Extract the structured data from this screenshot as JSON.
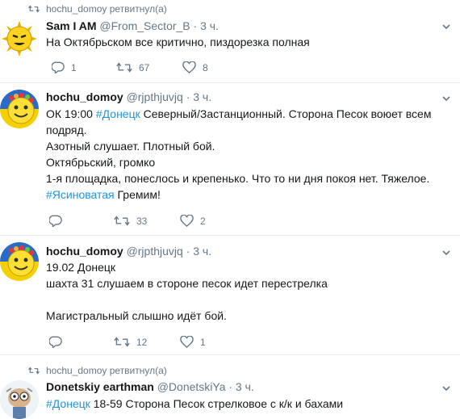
{
  "tweets": [
    {
      "retweet_label": "hochu_domoy ретвитнул(а)",
      "name": "Sam I AM",
      "handle": "@From_Sector_B",
      "time": "· 3 ч.",
      "text": "На Октябрьском все критично, пиздорезка полная",
      "replies": "1",
      "retweets": "67",
      "likes": "8"
    },
    {
      "name": "hochu_domoy",
      "handle": "@rjpthjuvjq",
      "time": "· 3 ч.",
      "line1_a": "ОК 19:00 ",
      "line1_hashtag": "#Донецк",
      "line1_b": " Северный/Застанционный. Сторона Песок воюет всем",
      "line2": "подряд.",
      "line3": "Азотный слушает. Плотный бой.",
      "line4": "Октябрьский, громко",
      "line5": "1-я площадка, понеслось и крепенько. Что то ни дня покоя нет. Тяжелое.",
      "line6_hashtag": "#Ясиноватая",
      "line6_b": " Гремим!",
      "replies": "",
      "retweets": "33",
      "likes": "2"
    },
    {
      "name": "hochu_domoy",
      "handle": "@rjpthjuvjq",
      "time": "· 3 ч.",
      "line1": "19.02 Донецк",
      "line2": "шахта 31 слушаем в стороне песок идет перестрелка",
      "line3": "Магистральный слышно идёт бой.",
      "replies": "",
      "retweets": "12",
      "likes": "1"
    },
    {
      "retweet_label": "hochu_domoy ретвитнул(а)",
      "name": "Donetskiy earthman",
      "handle": "@DonetskiYa",
      "time": "· 3 ч.",
      "text_hashtag": "#Донецк",
      "text_b": " 18-59 Сторона Песок стрелковое с к/к и бахами"
    }
  ],
  "icons": {
    "reply": "reply-icon",
    "retweet": "retweet-icon",
    "like": "heart-icon",
    "more": "chevron-down-icon"
  },
  "colors": {
    "hashtag": "#1b95e0",
    "secondary_text": "#657786",
    "divider": "#e6ecf0"
  }
}
